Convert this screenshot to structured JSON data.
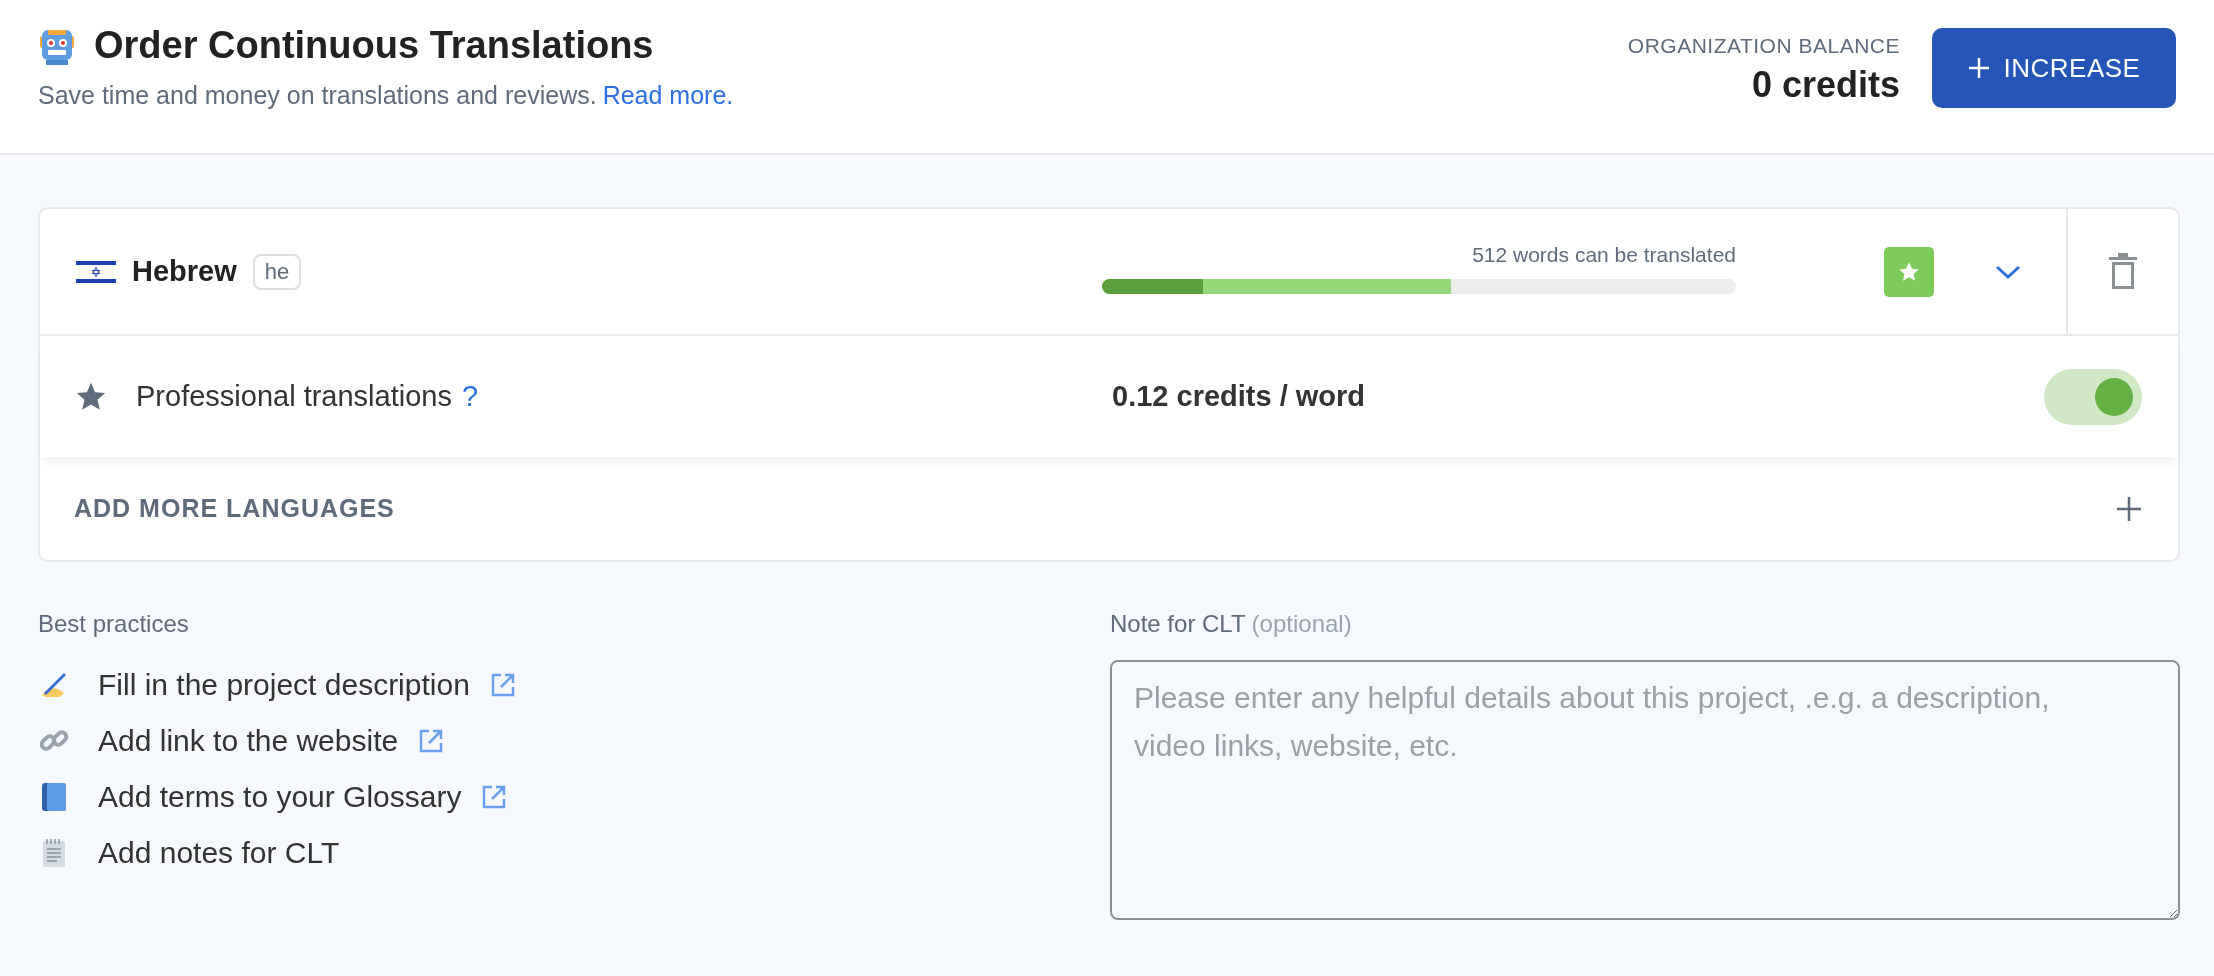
{
  "header": {
    "title": "Order Continuous Translations",
    "subtitle": "Save time and money on translations and reviews.",
    "link": "Read more."
  },
  "balance": {
    "label": "ORGANIZATION BALANCE",
    "value": "0 credits"
  },
  "increase_button": {
    "label": "INCREASE"
  },
  "languages": [
    {
      "name": "Hebrew",
      "code": "he",
      "progress_text": "512 words can be translated",
      "segments": [
        {
          "color": "#5b9e3b",
          "level": 0.16
        },
        {
          "color": "#95d97b",
          "level": 0.39
        }
      ],
      "starred": true,
      "expanded": false,
      "options": [
        {
          "kind": "toggle",
          "label": "Professional translations",
          "help": "?",
          "price": "0.12 credits / word",
          "on": true
        }
      ]
    }
  ],
  "add_more": {
    "label": "ADD MORE LANGUAGES"
  },
  "best_practices": {
    "heading": "Best practices",
    "items": [
      {
        "kind": "writing",
        "text": "Fill in the project description",
        "external": true
      },
      {
        "kind": "link",
        "text": "Add link to the website",
        "external": true
      },
      {
        "kind": "book",
        "text": "Add terms to your Glossary",
        "external": true
      },
      {
        "kind": "notepad",
        "text": "Add notes for CLT",
        "external": false
      }
    ]
  },
  "note": {
    "label": "Note for CLT",
    "hint": "(optional)",
    "placeholder": "Please enter any helpful details about this project, .e.g. a description, video links, website, etc."
  }
}
